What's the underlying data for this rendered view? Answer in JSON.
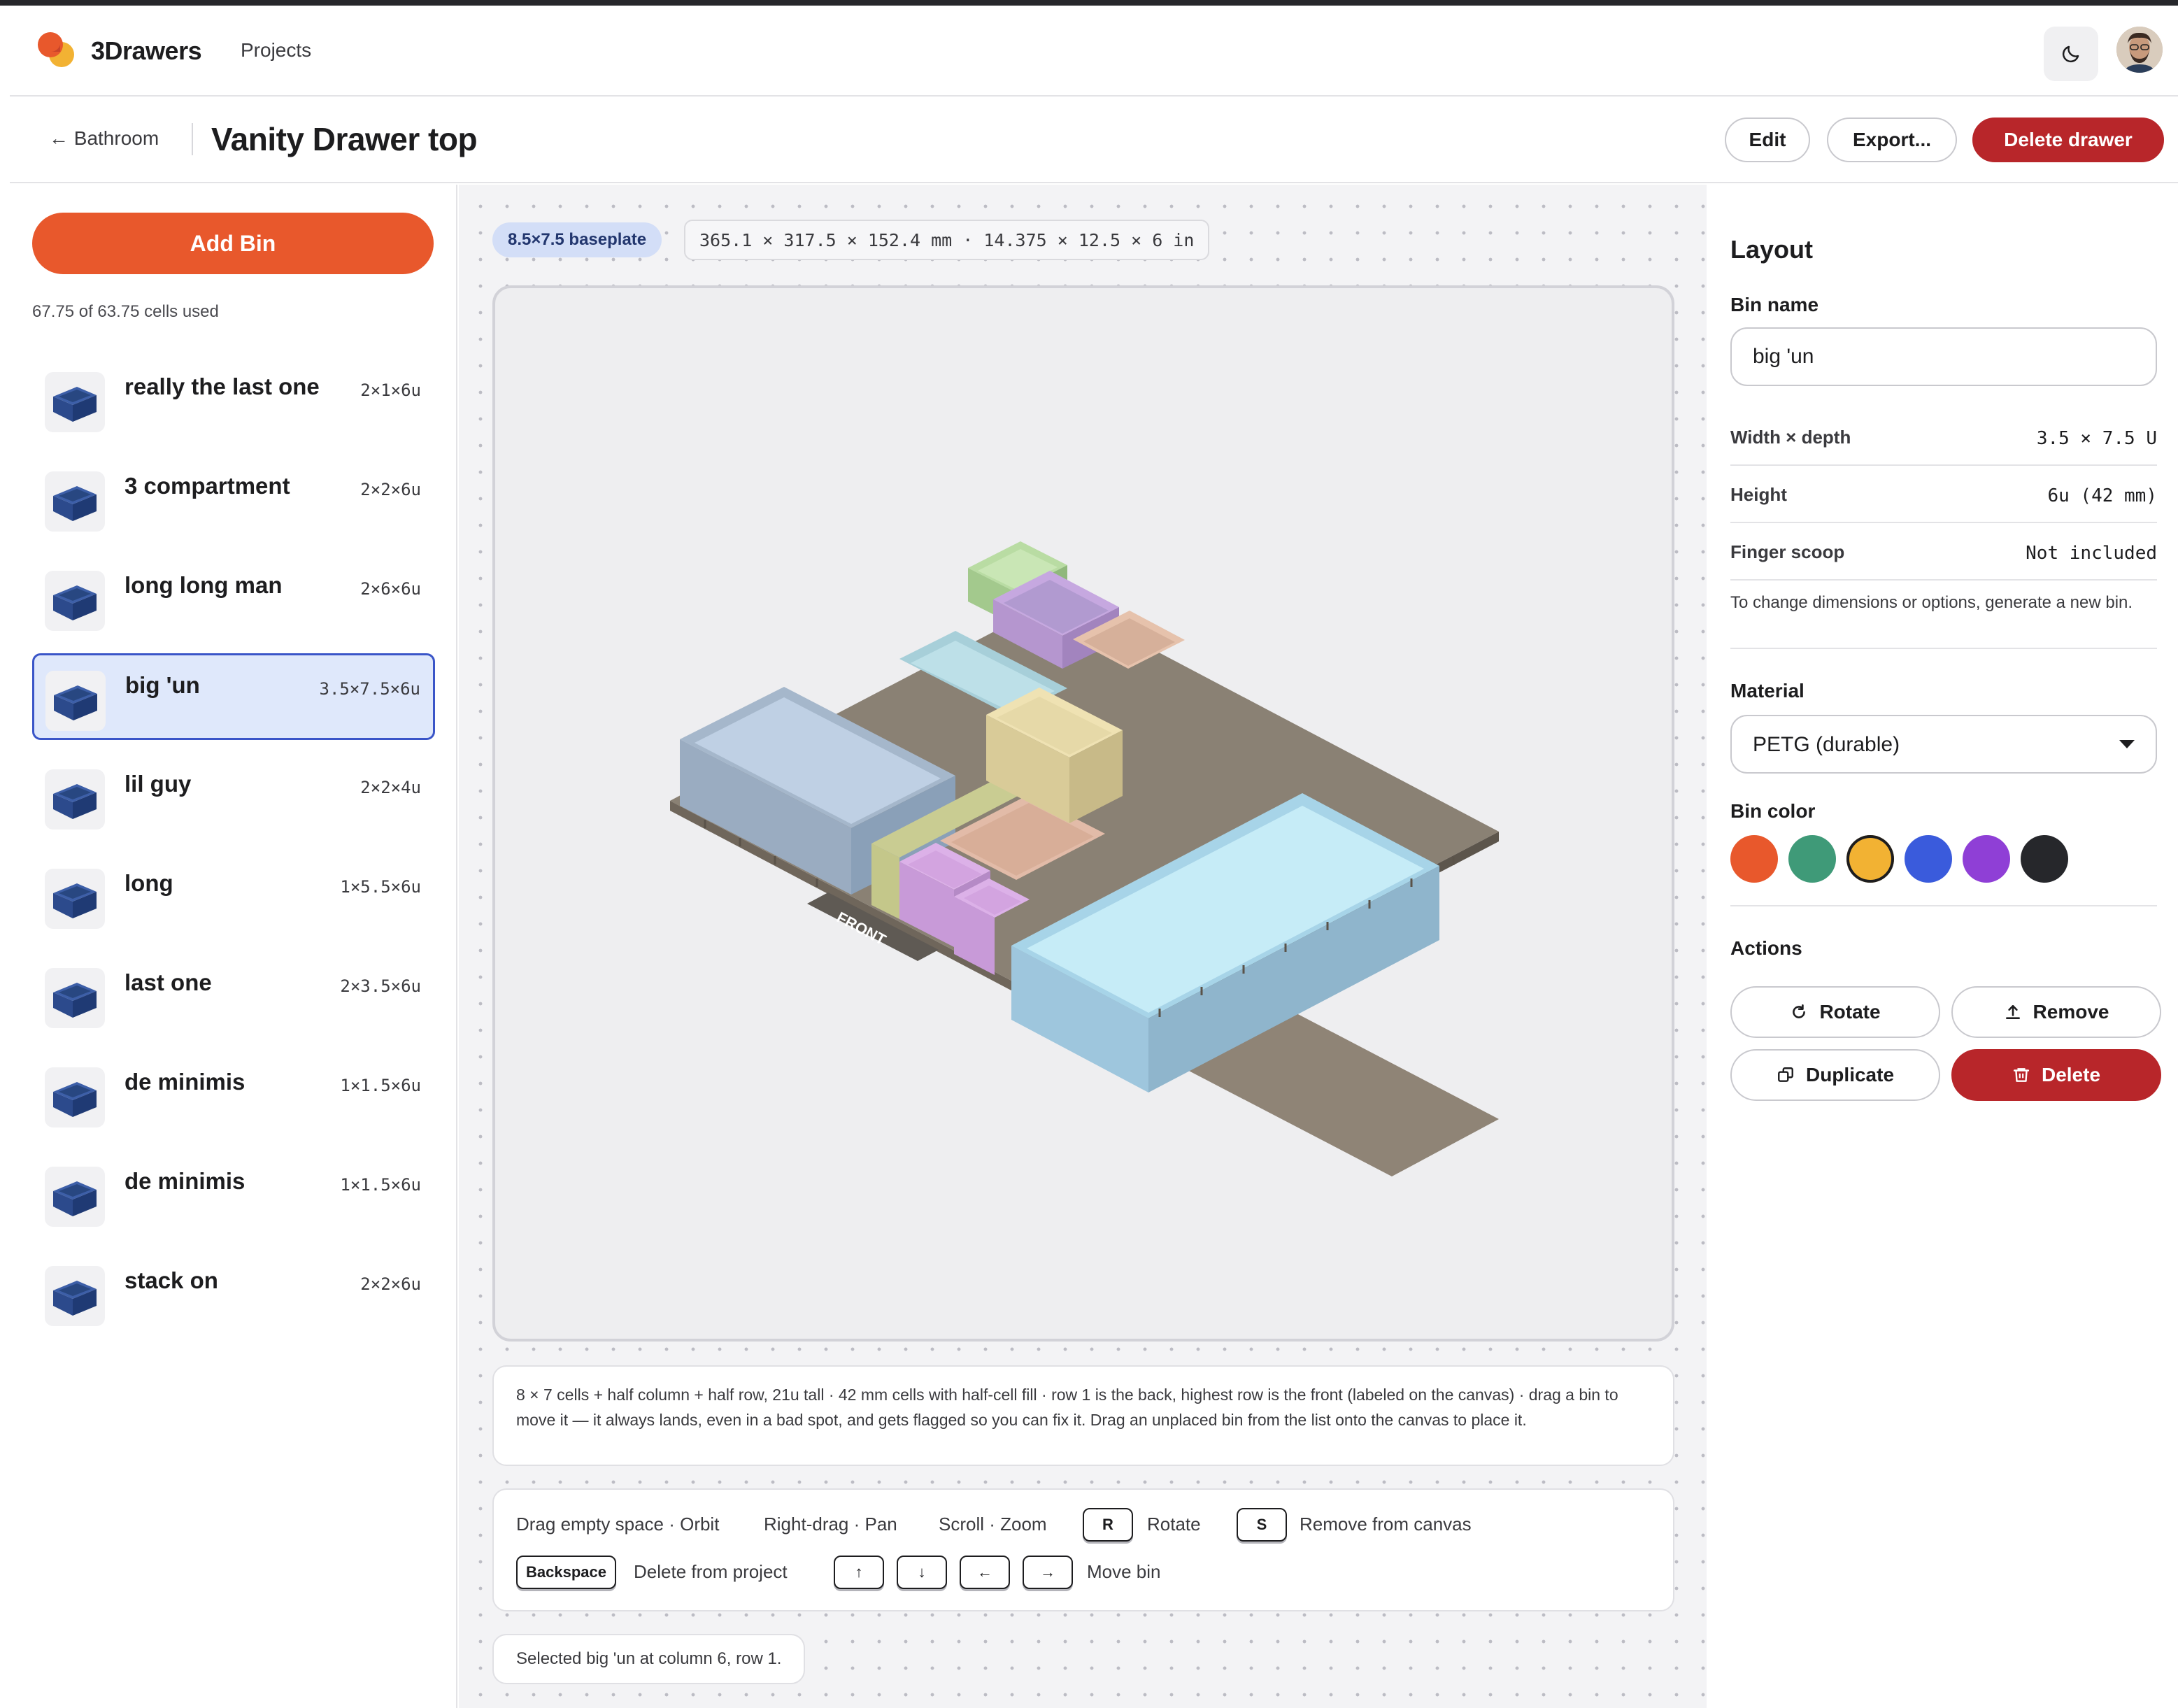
{
  "app": {
    "name": "3Drawers",
    "nav_projects": "Projects"
  },
  "breadcrumb": {
    "back_label": "← Bathroom",
    "title": "Vanity Drawer top"
  },
  "toolbar": {
    "edit_label": "Edit",
    "export_label": "Export...",
    "delete_drawer_label": "Delete drawer"
  },
  "sidebar": {
    "add_bin_label": "Add Bin",
    "cells_used": "67.75 of 63.75 cells used",
    "bins": [
      {
        "name": "really the last one",
        "size": "2×1×6u"
      },
      {
        "name": "3 compartment",
        "size": "2×2×6u"
      },
      {
        "name": "long long man",
        "size": "2×6×6u"
      },
      {
        "name": "big 'un",
        "size": "3.5×7.5×6u",
        "selected": true
      },
      {
        "name": "lil guy",
        "size": "2×2×4u"
      },
      {
        "name": "long",
        "size": "1×5.5×6u"
      },
      {
        "name": "last one",
        "size": "2×3.5×6u"
      },
      {
        "name": "de minimis",
        "size": "1×1.5×6u"
      },
      {
        "name": "de minimis",
        "size": "1×1.5×6u"
      },
      {
        "name": "stack on",
        "size": "2×2×6u"
      }
    ]
  },
  "canvas": {
    "baseplate_badge": "8.5×7.5 baseplate",
    "dimensions": "365.1 × 317.5 × 152.4 mm · 14.375 × 12.5 × 6 in",
    "front_label": "FRONT",
    "info_text": "8 × 7 cells + half column + half row, 21u tall · 42 mm cells with half-cell fill · row 1 is the back, highest row is the front (labeled on the canvas) · drag a bin to move it — it always lands, even in a bad spot, and gets flagged so you can fix it. Drag an unplaced bin from the list onto the canvas to place it.",
    "shortcuts": {
      "orbit": "Drag empty space · Orbit",
      "pan": "Right-drag · Pan",
      "zoom": "Scroll · Zoom",
      "rotate_key": "R",
      "rotate_label": "Rotate",
      "remove_key": "S",
      "remove_label": "Remove from canvas",
      "delete_key": "Backspace",
      "delete_label": "Delete from project",
      "up_key": "↑",
      "down_key": "↓",
      "left_key": "←",
      "right_key": "→",
      "move_label": "Move bin"
    },
    "status": "Selected big 'un at column 6, row 1."
  },
  "panel": {
    "title": "Layout",
    "bin_name_label": "Bin name",
    "bin_name_value": "big 'un",
    "width_depth_label": "Width × depth",
    "width_depth_value": "3.5 × 7.5 U",
    "height_label": "Height",
    "height_value": "6u (42 mm)",
    "scoop_label": "Finger scoop",
    "scoop_value": "Not included",
    "dims_note": "To change dimensions or options, generate a new bin.",
    "material_label": "Material",
    "material_value": "PETG (durable)",
    "color_label": "Bin color",
    "colors": [
      "#e8582c",
      "#3f9a78",
      "#f2b233",
      "#3a5bdc",
      "#8f3fd6",
      "#26272b"
    ],
    "selected_color": "#f2b233",
    "actions_label": "Actions",
    "rotate_label": "Rotate",
    "remove_label": "Remove",
    "duplicate_label": "Duplicate",
    "delete_label": "Delete"
  }
}
